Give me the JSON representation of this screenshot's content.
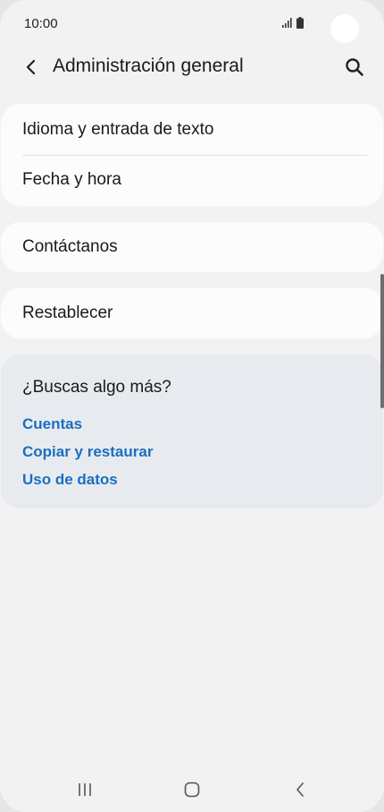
{
  "status_bar": {
    "time": "10:00"
  },
  "header": {
    "title": "Administración general",
    "back_icon": "chevron-left-icon",
    "search_icon": "search-icon"
  },
  "groups": [
    {
      "items": [
        {
          "label": "Idioma y entrada de texto"
        },
        {
          "label": "Fecha y hora"
        }
      ]
    },
    {
      "items": [
        {
          "label": "Contáctanos"
        }
      ]
    },
    {
      "items": [
        {
          "label": "Restablecer"
        }
      ]
    }
  ],
  "suggestions": {
    "title": "¿Buscas algo más?",
    "links": [
      {
        "label": "Cuentas"
      },
      {
        "label": "Copiar y restaurar"
      },
      {
        "label": "Uso de datos"
      }
    ]
  },
  "colors": {
    "background": "#f2f2f2",
    "card": "#fcfcfc",
    "suggestion_card": "#e7ebf0",
    "link": "#1c6ebf",
    "text": "#1a1a1a"
  }
}
